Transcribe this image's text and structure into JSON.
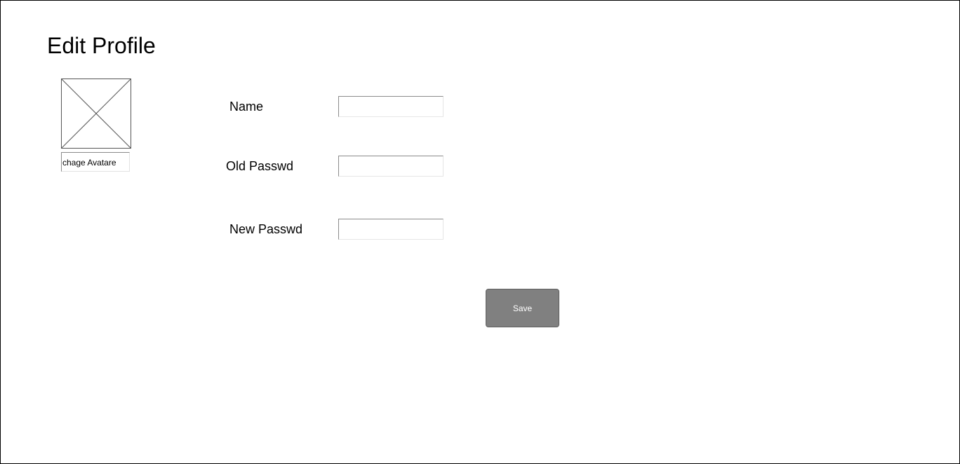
{
  "page": {
    "title": "Edit Profile"
  },
  "avatar": {
    "icon": "image-placeholder-icon",
    "change_label": "chage Avatare"
  },
  "form": {
    "name_label": "Name",
    "name_value": "",
    "old_password_label": "Old Passwd",
    "old_password_value": "",
    "new_password_label": "New Passwd",
    "new_password_value": ""
  },
  "actions": {
    "save_label": "Save"
  },
  "colors": {
    "save_button_bg": "#808080",
    "save_button_text": "#ffffff",
    "frame_border": "#000000"
  }
}
